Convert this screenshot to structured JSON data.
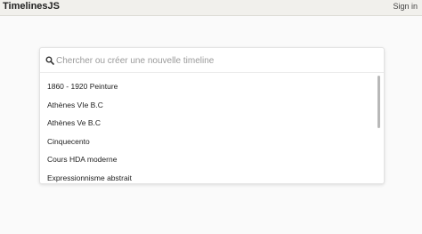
{
  "header": {
    "brand": "TimelinesJS",
    "signin_label": "Sign in"
  },
  "search": {
    "placeholder": "Chercher ou créer une nouvelle timeline",
    "value": ""
  },
  "timelines": [
    {
      "label": "1860 - 1920 Peinture"
    },
    {
      "label": "Athènes VIe B.C"
    },
    {
      "label": "Athènes Ve B.C"
    },
    {
      "label": "Cinquecento"
    },
    {
      "label": "Cours HDA moderne"
    },
    {
      "label": "Expressionnisme abstrait"
    }
  ],
  "icons": {
    "search": "search-icon"
  }
}
